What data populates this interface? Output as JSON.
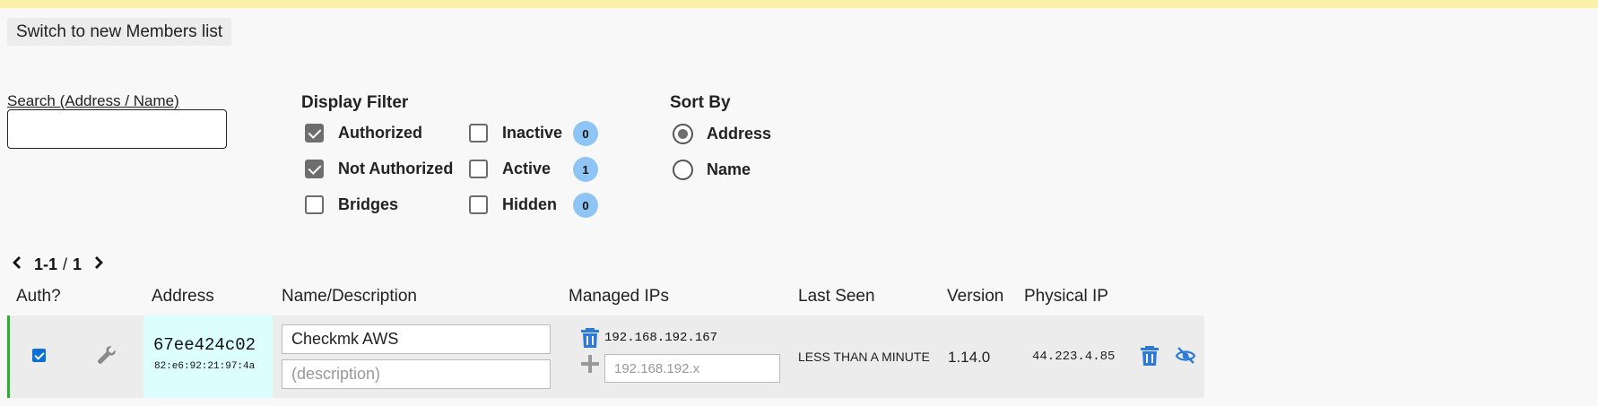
{
  "switch_button": "Switch to new Members list",
  "search": {
    "label": "Search (Address / Name)",
    "value": ""
  },
  "display_filter": {
    "title": "Display Filter",
    "options": [
      {
        "label": "Authorized",
        "checked": true
      },
      {
        "label": "Not Authorized",
        "checked": true
      },
      {
        "label": "Bridges",
        "checked": false
      },
      {
        "label": "Inactive",
        "checked": false,
        "count": "0"
      },
      {
        "label": "Active",
        "checked": false,
        "count": "1"
      },
      {
        "label": "Hidden",
        "checked": false,
        "count": "0"
      }
    ]
  },
  "sort_by": {
    "title": "Sort By",
    "options": [
      {
        "label": "Address",
        "selected": true
      },
      {
        "label": "Name",
        "selected": false
      }
    ]
  },
  "pager": {
    "range": "1-1",
    "sep": "/",
    "total": "1"
  },
  "table": {
    "headers": {
      "auth": "Auth?",
      "address": "Address",
      "name": "Name/Description",
      "ips": "Managed IPs",
      "last_seen": "Last Seen",
      "version": "Version",
      "physical_ip": "Physical IP"
    },
    "rows": [
      {
        "authorized": true,
        "address": "67ee424c02",
        "mac": "82:e6:92:21:97:4a",
        "name": "Checkmk AWS",
        "description_placeholder": "(description)",
        "managed_ip": "192.168.192.167",
        "new_ip_placeholder": "192.168.192.x",
        "last_seen": "LESS THAN A MINUTE",
        "version": "1.14.0",
        "physical_ip": "44.223.4.85"
      }
    ]
  },
  "colors": {
    "accent": "#2e7bd6",
    "badge": "#8ec5f5",
    "authorized_border": "#2bb02b",
    "address_cell": "#dcfeff",
    "top_banner": "#fbf2a9"
  }
}
